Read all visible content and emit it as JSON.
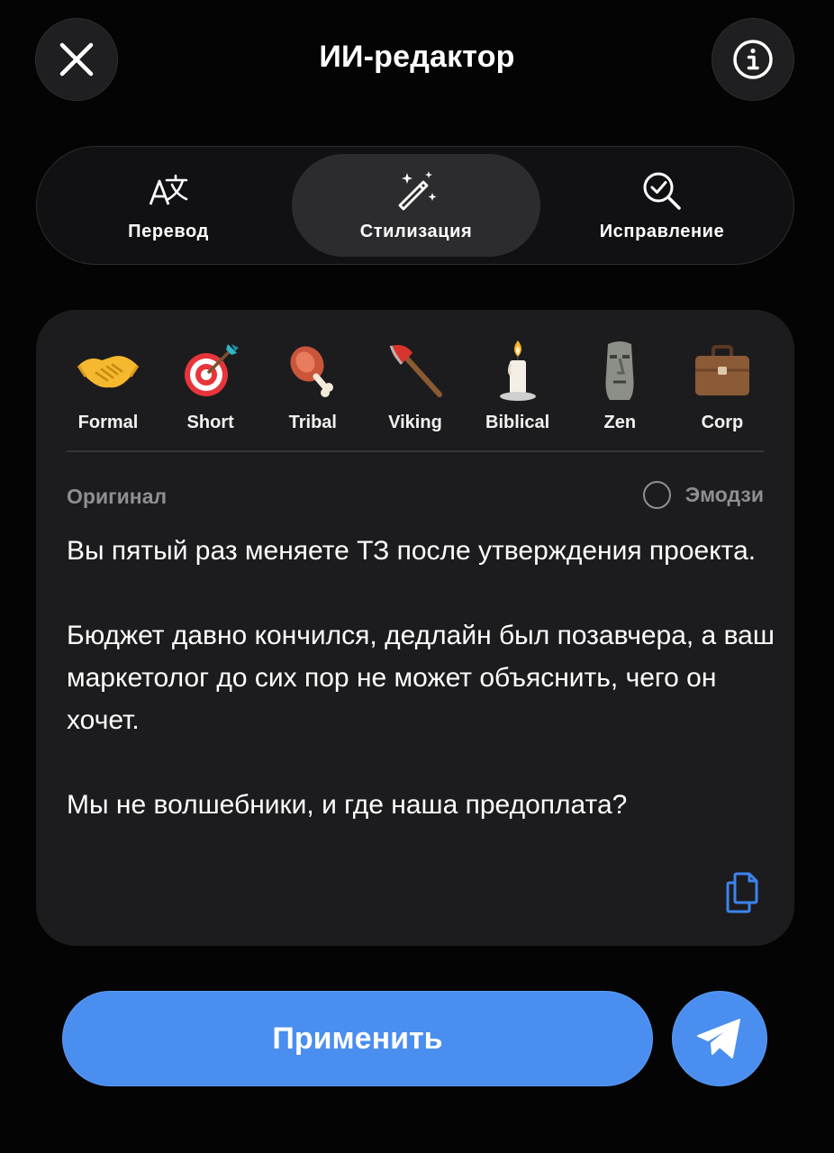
{
  "header": {
    "title": "ИИ-редактор",
    "close_icon": "close-icon",
    "info_icon": "info-icon"
  },
  "tabs": [
    {
      "label": "Перевод",
      "icon": "translate-icon",
      "active": false
    },
    {
      "label": "Стилизация",
      "icon": "magic-wand-icon",
      "active": true
    },
    {
      "label": "Исправление",
      "icon": "search-check-icon",
      "active": false
    }
  ],
  "styles": [
    {
      "label": "Formal",
      "icon": "handshake-icon"
    },
    {
      "label": "Short",
      "icon": "target-icon"
    },
    {
      "label": "Tribal",
      "icon": "meat-on-bone-icon"
    },
    {
      "label": "Viking",
      "icon": "axe-icon"
    },
    {
      "label": "Biblical",
      "icon": "candle-icon"
    },
    {
      "label": "Zen",
      "icon": "moai-icon"
    },
    {
      "label": "Corp",
      "icon": "briefcase-icon"
    }
  ],
  "card": {
    "original_label": "Оригинал",
    "emoji_toggle_label": "Эмодзи",
    "emoji_enabled": false,
    "paragraphs": [
      "Вы пятый раз меняете ТЗ после утверждения проекта.",
      "Бюджет давно кончился, дедлайн был позавчера, а ваш маркетолог до сих пор не может объяснить, чего он хочет.",
      "Мы не волшебники, и где наша предоплата?"
    ]
  },
  "footer": {
    "apply_label": "Применить",
    "send_icon": "send-icon"
  },
  "colors": {
    "accent": "#4a8ef0",
    "card_bg": "#1c1c1e",
    "muted_text": "#8e8e93",
    "copy_icon": "#3d84f0"
  }
}
